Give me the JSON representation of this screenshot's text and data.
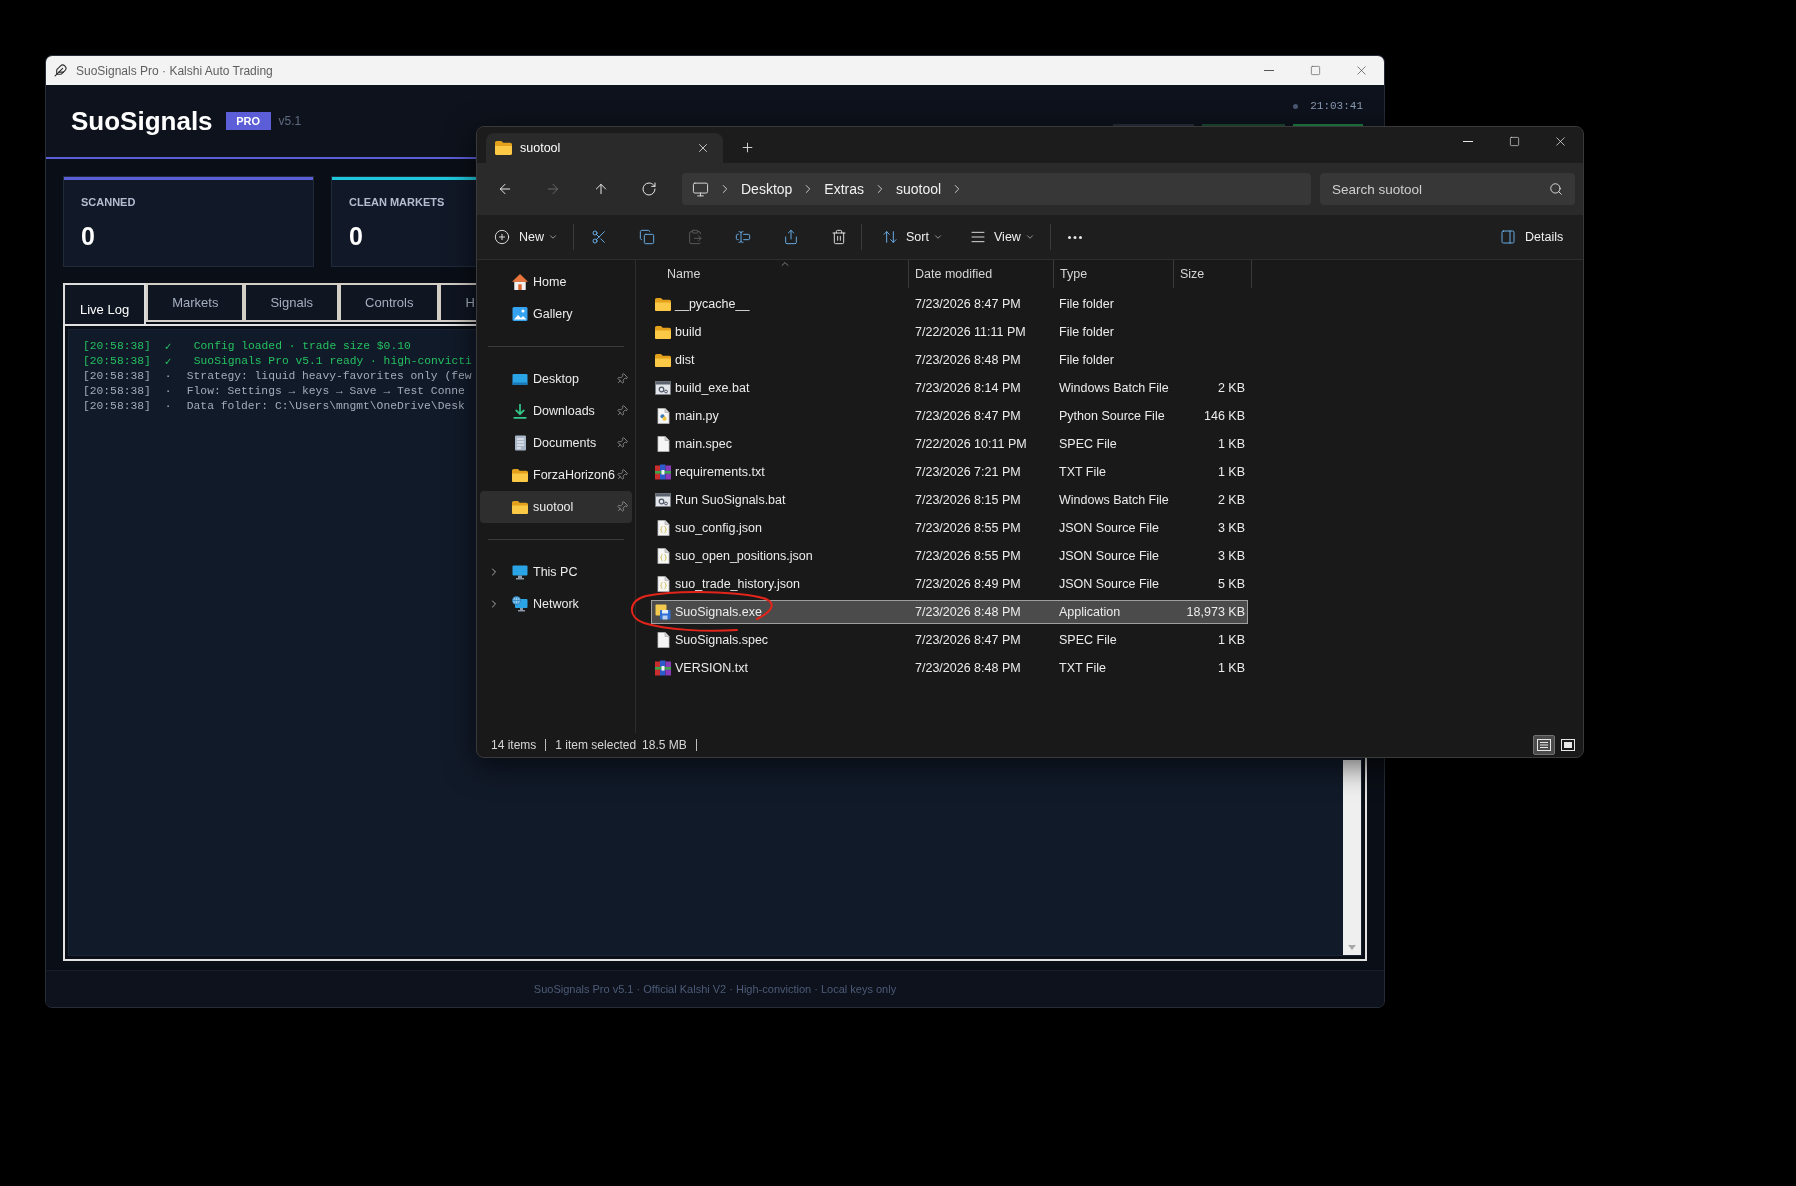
{
  "app": {
    "title": "SuoSignals Pro · Kalshi Auto Trading",
    "brand": "SuoSignals",
    "badge": "PRO",
    "version": "v5.1",
    "clock": "21:03:41",
    "stats": [
      {
        "label": "SCANNED",
        "value": "0",
        "color": "#5b5ed6"
      },
      {
        "label": "CLEAN MARKETS",
        "value": "0",
        "color": "#1ec8dc"
      }
    ],
    "tabs": [
      {
        "label": "Live Log",
        "selected": true
      },
      {
        "label": "Markets",
        "selected": false
      },
      {
        "label": "Signals",
        "selected": false
      },
      {
        "label": "Controls",
        "selected": false
      },
      {
        "label": "H",
        "selected": false
      }
    ],
    "log": [
      {
        "kind": "ok",
        "time": "[20:58:38]",
        "marker": "✓",
        "message": "Config loaded · trade size $0.10"
      },
      {
        "kind": "ok",
        "time": "[20:58:38]",
        "marker": "✓",
        "message": "SuoSignals Pro v5.1 ready · high-convicti"
      },
      {
        "kind": "info",
        "time": "[20:58:38]",
        "marker": "·",
        "message": "Strategy: liquid heavy-favorites only (few"
      },
      {
        "kind": "info",
        "time": "[20:58:38]",
        "marker": "·",
        "message": "Flow: Settings → keys → Save → Test Conne"
      },
      {
        "kind": "info",
        "time": "[20:58:38]",
        "marker": "·",
        "message": "Data folder: C:\\Users\\mngmt\\OneDrive\\Desk"
      }
    ],
    "footer": "SuoSignals Pro v5.1 · Official Kalshi V2 · High-conviction · Local keys only"
  },
  "explorer": {
    "tab_title": "suotool",
    "nav_buttons": [
      {
        "kind": "back",
        "disabled": false
      },
      {
        "kind": "forward",
        "disabled": true
      },
      {
        "kind": "up",
        "disabled": false
      },
      {
        "kind": "refresh",
        "disabled": false
      }
    ],
    "breadcrumb": [
      "Desktop",
      "Extras",
      "suotool"
    ],
    "search": {
      "placeholder": "Search suotool"
    },
    "commands": [
      {
        "kind": "new",
        "label": "New",
        "disabled": false
      },
      {
        "kind": "cut",
        "disabled": false
      },
      {
        "kind": "copy",
        "disabled": false
      },
      {
        "kind": "paste",
        "disabled": true
      },
      {
        "kind": "rename",
        "disabled": false
      },
      {
        "kind": "share",
        "disabled": false
      },
      {
        "kind": "delete",
        "disabled": false
      },
      {
        "kind": "sort",
        "label": "Sort",
        "disabled": false
      },
      {
        "kind": "view",
        "label": "View",
        "disabled": false
      },
      {
        "kind": "more",
        "disabled": false
      }
    ],
    "details_button": "Details",
    "sidebar": [
      {
        "items": [
          {
            "kind": "home",
            "label": "Home",
            "selected": false
          },
          {
            "kind": "gallery",
            "label": "Gallery",
            "selected": false
          }
        ]
      },
      {
        "items": [
          {
            "kind": "desktop",
            "label": "Desktop",
            "pinned": true,
            "selected": false
          },
          {
            "kind": "downloads",
            "label": "Downloads",
            "pinned": true,
            "selected": false
          },
          {
            "kind": "documents",
            "label": "Documents",
            "pinned": true,
            "selected": false
          },
          {
            "kind": "folder",
            "label": "ForzaHorizon6",
            "pinned": true,
            "selected": false
          },
          {
            "kind": "folder",
            "label": "suotool",
            "pinned": true,
            "selected": true
          }
        ]
      },
      {
        "items": [
          {
            "kind": "pc",
            "label": "This PC",
            "expanded": false,
            "selected": false
          },
          {
            "kind": "network",
            "label": "Network",
            "expanded": false,
            "selected": false
          }
        ]
      }
    ],
    "columns": [
      "Name",
      "Date modified",
      "Type",
      "Size"
    ],
    "rows": [
      {
        "kind": "folder",
        "name": "__pycache__",
        "date": "7/23/2026 8:47 PM",
        "type": "File folder",
        "selected": false
      },
      {
        "kind": "folder",
        "name": "build",
        "date": "7/22/2026 11:11 PM",
        "type": "File folder",
        "selected": false
      },
      {
        "kind": "folder",
        "name": "dist",
        "date": "7/23/2026 8:48 PM",
        "type": "File folder",
        "selected": false
      },
      {
        "kind": "batch",
        "name": "build_exe.bat",
        "date": "7/23/2026 8:14 PM",
        "type": "Windows Batch File",
        "size": "2 KB",
        "selected": false
      },
      {
        "kind": "python",
        "name": "main.py",
        "date": "7/23/2026 8:47 PM",
        "type": "Python Source File",
        "size": "146 KB",
        "selected": false
      },
      {
        "kind": "blank",
        "name": "main.spec",
        "date": "7/22/2026 10:11 PM",
        "type": "SPEC File",
        "size": "1 KB",
        "selected": false
      },
      {
        "kind": "text",
        "name": "requirements.txt",
        "date": "7/23/2026 7:21 PM",
        "type": "TXT File",
        "size": "1 KB",
        "selected": false
      },
      {
        "kind": "batch",
        "name": "Run SuoSignals.bat",
        "date": "7/23/2026 8:15 PM",
        "type": "Windows Batch File",
        "size": "2 KB",
        "selected": false
      },
      {
        "kind": "json",
        "name": "suo_config.json",
        "date": "7/23/2026 8:55 PM",
        "type": "JSON Source File",
        "size": "3 KB",
        "selected": false
      },
      {
        "kind": "json",
        "name": "suo_open_positions.json",
        "date": "7/23/2026 8:55 PM",
        "type": "JSON Source File",
        "size": "3 KB",
        "selected": false
      },
      {
        "kind": "json",
        "name": "suo_trade_history.json",
        "date": "7/23/2026 8:49 PM",
        "type": "JSON Source File",
        "size": "5 KB",
        "selected": false
      },
      {
        "kind": "application",
        "name": "SuoSignals.exe",
        "date": "7/23/2026 8:48 PM",
        "type": "Application",
        "size": "18,973 KB",
        "selected": true
      },
      {
        "kind": "blank",
        "name": "SuoSignals.spec",
        "date": "7/23/2026 8:47 PM",
        "type": "SPEC File",
        "size": "1 KB",
        "selected": false
      },
      {
        "kind": "text",
        "name": "VERSION.txt",
        "date": "7/23/2026 8:48 PM",
        "type": "TXT File",
        "size": "1 KB",
        "selected": false
      }
    ],
    "status_bar": {
      "item_count": "14 items",
      "selection": "1 item selected",
      "selection_size": "18.5 MB"
    },
    "view_modes": [
      {
        "kind": "details",
        "selected": true
      },
      {
        "kind": "tiles",
        "selected": false
      }
    ]
  }
}
